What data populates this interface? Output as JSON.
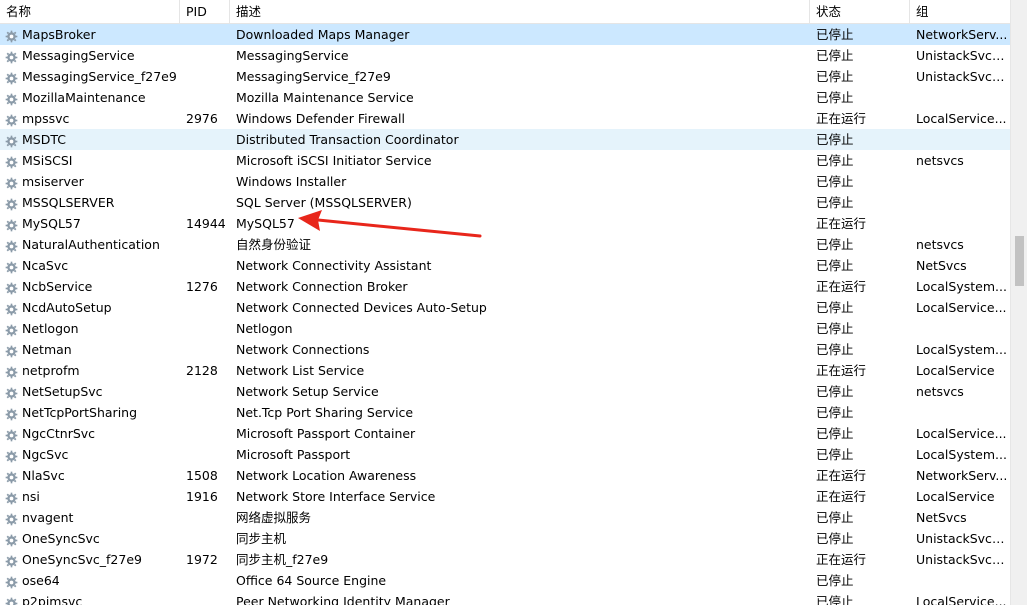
{
  "columns": {
    "name": "名称",
    "pid": "PID",
    "desc": "描述",
    "status": "状态",
    "group": "组"
  },
  "services": [
    {
      "name": "MapsBroker",
      "pid": "",
      "desc": "Downloaded Maps Manager",
      "status": "已停止",
      "group": "NetworkServ..."
    },
    {
      "name": "MessagingService",
      "pid": "",
      "desc": "MessagingService",
      "status": "已停止",
      "group": "UnistackSvcG..."
    },
    {
      "name": "MessagingService_f27e9",
      "pid": "",
      "desc": "MessagingService_f27e9",
      "status": "已停止",
      "group": "UnistackSvcG..."
    },
    {
      "name": "MozillaMaintenance",
      "pid": "",
      "desc": "Mozilla Maintenance Service",
      "status": "已停止",
      "group": ""
    },
    {
      "name": "mpssvc",
      "pid": "2976",
      "desc": "Windows Defender Firewall",
      "status": "正在运行",
      "group": "LocalService..."
    },
    {
      "name": "MSDTC",
      "pid": "",
      "desc": "Distributed Transaction Coordinator",
      "status": "已停止",
      "group": ""
    },
    {
      "name": "MSiSCSI",
      "pid": "",
      "desc": "Microsoft iSCSI Initiator Service",
      "status": "已停止",
      "group": "netsvcs"
    },
    {
      "name": "msiserver",
      "pid": "",
      "desc": "Windows Installer",
      "status": "已停止",
      "group": ""
    },
    {
      "name": "MSSQLSERVER",
      "pid": "",
      "desc": "SQL Server (MSSQLSERVER)",
      "status": "已停止",
      "group": ""
    },
    {
      "name": "MySQL57",
      "pid": "14944",
      "desc": "MySQL57",
      "status": "正在运行",
      "group": ""
    },
    {
      "name": "NaturalAuthentication",
      "pid": "",
      "desc": "自然身份验证",
      "status": "已停止",
      "group": "netsvcs"
    },
    {
      "name": "NcaSvc",
      "pid": "",
      "desc": "Network Connectivity Assistant",
      "status": "已停止",
      "group": "NetSvcs"
    },
    {
      "name": "NcbService",
      "pid": "1276",
      "desc": "Network Connection Broker",
      "status": "正在运行",
      "group": "LocalSystem..."
    },
    {
      "name": "NcdAutoSetup",
      "pid": "",
      "desc": "Network Connected Devices Auto-Setup",
      "status": "已停止",
      "group": "LocalService..."
    },
    {
      "name": "Netlogon",
      "pid": "",
      "desc": "Netlogon",
      "status": "已停止",
      "group": ""
    },
    {
      "name": "Netman",
      "pid": "",
      "desc": "Network Connections",
      "status": "已停止",
      "group": "LocalSystem..."
    },
    {
      "name": "netprofm",
      "pid": "2128",
      "desc": "Network List Service",
      "status": "正在运行",
      "group": "LocalService"
    },
    {
      "name": "NetSetupSvc",
      "pid": "",
      "desc": "Network Setup Service",
      "status": "已停止",
      "group": "netsvcs"
    },
    {
      "name": "NetTcpPortSharing",
      "pid": "",
      "desc": "Net.Tcp Port Sharing Service",
      "status": "已停止",
      "group": ""
    },
    {
      "name": "NgcCtnrSvc",
      "pid": "",
      "desc": "Microsoft Passport Container",
      "status": "已停止",
      "group": "LocalService..."
    },
    {
      "name": "NgcSvc",
      "pid": "",
      "desc": "Microsoft Passport",
      "status": "已停止",
      "group": "LocalSystem..."
    },
    {
      "name": "NlaSvc",
      "pid": "1508",
      "desc": "Network Location Awareness",
      "status": "正在运行",
      "group": "NetworkServ..."
    },
    {
      "name": "nsi",
      "pid": "1916",
      "desc": "Network Store Interface Service",
      "status": "正在运行",
      "group": "LocalService"
    },
    {
      "name": "nvagent",
      "pid": "",
      "desc": "网络虚拟服务",
      "status": "已停止",
      "group": "NetSvcs"
    },
    {
      "name": "OneSyncSvc",
      "pid": "",
      "desc": "同步主机",
      "status": "已停止",
      "group": "UnistackSvcG..."
    },
    {
      "name": "OneSyncSvc_f27e9",
      "pid": "1972",
      "desc": "同步主机_f27e9",
      "status": "正在运行",
      "group": "UnistackSvcG..."
    },
    {
      "name": "ose64",
      "pid": "",
      "desc": "Office 64 Source Engine",
      "status": "已停止",
      "group": ""
    },
    {
      "name": "p2pimsvc",
      "pid": "",
      "desc": "Peer Networking Identity Manager",
      "status": "已停止",
      "group": "LocalService..."
    }
  ],
  "selected_row": 0,
  "hover_row": 5,
  "colors": {
    "selected_bg": "#cce8ff",
    "hover_bg": "#e5f3fb",
    "annotation_arrow": "#e8261b"
  }
}
